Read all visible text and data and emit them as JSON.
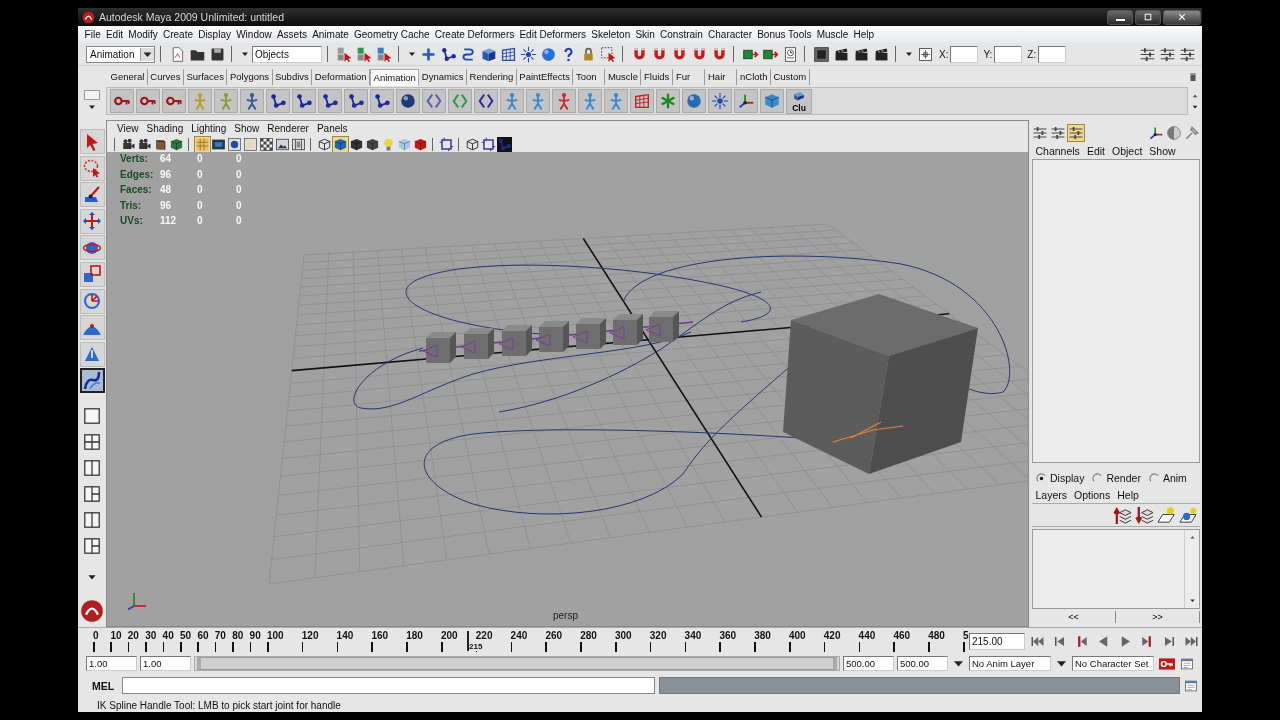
{
  "window": {
    "title": "Autodesk Maya 2009 Unlimited: untitled"
  },
  "menu_bar": [
    "File",
    "Edit",
    "Modify",
    "Create",
    "Display",
    "Window",
    "Assets",
    "Animate",
    "Geometry Cache",
    "Create Deformers",
    "Edit Deformers",
    "Skeleton",
    "Skin",
    "Constrain",
    "Character",
    "Bonus Tools",
    "Muscle",
    "Help"
  ],
  "status_line": {
    "menu_set": "Animation",
    "selection_mode": "Objects",
    "coordinates": [
      {
        "label": "X:"
      },
      {
        "label": "Y:"
      },
      {
        "label": "Z:"
      }
    ]
  },
  "shelf": {
    "tabs": [
      {
        "label": "General",
        "selected": false
      },
      {
        "label": "Curves",
        "selected": false
      },
      {
        "label": "Surfaces",
        "selected": false
      },
      {
        "label": "Polygons",
        "selected": false
      },
      {
        "label": "Subdivs",
        "selected": false
      },
      {
        "label": "Deformation",
        "selected": false
      },
      {
        "label": "Animation",
        "selected": true
      },
      {
        "label": "Dynamics",
        "selected": false
      },
      {
        "label": "Rendering",
        "selected": false
      },
      {
        "label": "PaintEffects",
        "selected": false
      },
      {
        "label": "Toon",
        "selected": false
      },
      {
        "label": "Muscle",
        "selected": false
      },
      {
        "label": "Fluids",
        "selected": false
      },
      {
        "label": "Fur",
        "selected": false
      },
      {
        "label": "Hair",
        "selected": false
      },
      {
        "label": "nCloth",
        "selected": false
      },
      {
        "label": "Custom",
        "selected": false
      }
    ],
    "button_caption": "Clu"
  },
  "toolbox": {
    "tools": [
      {
        "kind": "select",
        "selected": false
      },
      {
        "kind": "lasso",
        "selected": false
      },
      {
        "kind": "paint",
        "selected": false
      },
      {
        "kind": "move",
        "selected": false
      },
      {
        "kind": "rotate",
        "selected": false
      },
      {
        "kind": "scale",
        "selected": false
      },
      {
        "kind": "manipulator",
        "selected": false
      },
      {
        "kind": "soft_modify",
        "selected": false
      },
      {
        "kind": "show_manipulator",
        "selected": false
      },
      {
        "kind": "last_tool",
        "selected": true
      }
    ]
  },
  "viewport": {
    "menu": [
      "View",
      "Shading",
      "Lighting",
      "Show",
      "Renderer",
      "Panels"
    ],
    "hud": [
      {
        "label": "Verts:",
        "values": [
          "64",
          "0",
          "0"
        ]
      },
      {
        "label": "Edges:",
        "values": [
          "96",
          "0",
          "0"
        ]
      },
      {
        "label": "Faces:",
        "values": [
          "48",
          "0",
          "0"
        ]
      },
      {
        "label": "Tris:",
        "values": [
          "96",
          "0",
          "0"
        ]
      },
      {
        "label": "UVs:",
        "values": [
          "112",
          "0",
          "0"
        ]
      }
    ],
    "camera": "persp"
  },
  "channel_box": {
    "menu": [
      "Channels",
      "Edit",
      "Object",
      "Show"
    ]
  },
  "layer_editor": {
    "modes": [
      {
        "label": "Display",
        "selected": true
      },
      {
        "label": "Render",
        "selected": false
      },
      {
        "label": "Anim",
        "selected": false
      }
    ],
    "menu": [
      "Layers",
      "Options",
      "Help"
    ],
    "page_buttons": [
      "<<",
      ">>"
    ]
  },
  "time_slider": {
    "ticks": [
      "0",
      "10",
      "20",
      "30",
      "40",
      "50",
      "60",
      "70",
      "80",
      "90",
      "100",
      "120",
      "140",
      "160",
      "180",
      "200",
      "220",
      "240",
      "260",
      "280",
      "300",
      "320",
      "340",
      "360",
      "380",
      "400",
      "420",
      "440",
      "460",
      "480",
      "5"
    ],
    "playhead": {
      "label": "215",
      "level": 0.43
    },
    "current_frame": "215.00"
  },
  "range_slider": {
    "start_time": "1.00",
    "playback_start": "1.00",
    "playback_end": "500.00",
    "end_time": "500.00"
  },
  "anim_layer": "No Anim Layer",
  "character_set": "No Character Set",
  "command_line": {
    "language": "MEL"
  },
  "help_line": "IK Spline Handle Tool: LMB to pick start joint for handle"
}
